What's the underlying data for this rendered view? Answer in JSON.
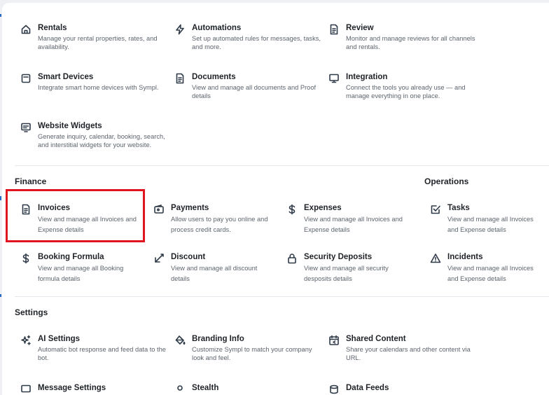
{
  "sections": {
    "finance": "Finance",
    "operations": "Operations",
    "settings": "Settings"
  },
  "items": {
    "rentals": {
      "title": "Rentals",
      "desc": "Manage your rental properties, rates, and availability."
    },
    "automations": {
      "title": "Automations",
      "desc": "Set up automated rules for messages, tasks, and more."
    },
    "review": {
      "title": "Review",
      "desc": "Monitor and manage reviews for all channels and rentals."
    },
    "smart_devices": {
      "title": "Smart Devices",
      "desc": "Integrate smart home devices with Sympl."
    },
    "documents": {
      "title": "Documents",
      "desc": "View and manage all documents and Proof details"
    },
    "integration": {
      "title": "Integration",
      "desc": "Connect the tools you already use — and manage everything in one place."
    },
    "website_widgets": {
      "title": "Website Widgets",
      "desc": "Generate inquiry, calendar, booking, search, and interstitial widgets for your website."
    },
    "invoices": {
      "title": "Invoices",
      "desc": "View and manage all Invoices and Expense details"
    },
    "payments": {
      "title": "Payments",
      "desc": "Allow users to pay you online and process credit cards."
    },
    "expenses": {
      "title": "Expenses",
      "desc": "View and manage all Invoices and Expense details"
    },
    "tasks": {
      "title": "Tasks",
      "desc": "View and manage all Invoices and Expense details"
    },
    "booking_formula": {
      "title": "Booking Formula",
      "desc": "View and manage all Booking formula details"
    },
    "discount": {
      "title": "Discount",
      "desc": "View and manage all discount details"
    },
    "security_deposits": {
      "title": "Security Deposits",
      "desc": "View and manage all security desposits details"
    },
    "incidents": {
      "title": "Incidents",
      "desc": "View and manage all Invoices and Expense details"
    },
    "ai_settings": {
      "title": "AI Settings",
      "desc": "Automatic bot response and feed data to the bot."
    },
    "branding_info": {
      "title": "Branding Info",
      "desc": "Customize Sympl to match your company look and feel."
    },
    "shared_content": {
      "title": "Shared Content",
      "desc": "Share your calendars and other content via URL."
    },
    "message_settings": {
      "title": "Message Settings"
    },
    "stealth": {
      "title": "Stealth"
    },
    "data_feeds": {
      "title": "Data Feeds"
    }
  },
  "colors": {
    "highlight": "#e0151f",
    "icon": "#2f3a48"
  }
}
